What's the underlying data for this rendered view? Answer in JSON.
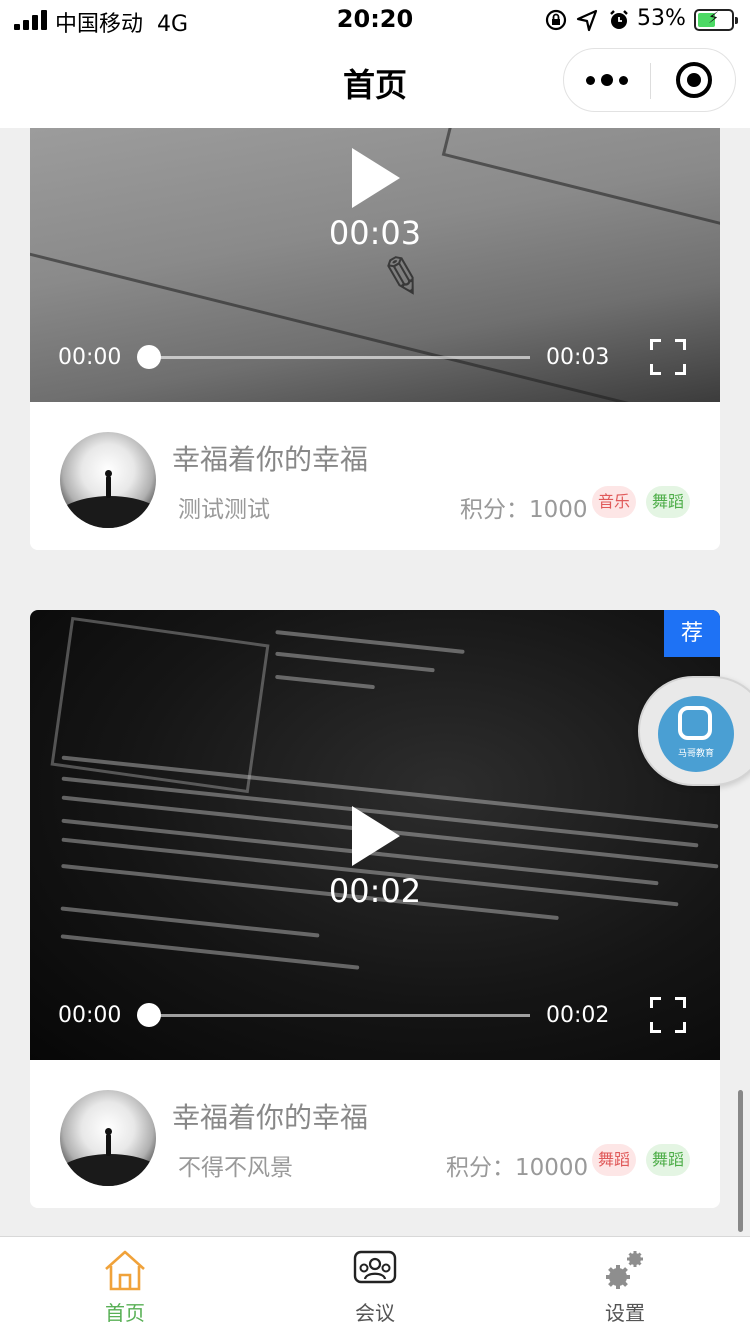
{
  "status_bar": {
    "carrier": "中国移动",
    "network": "4G",
    "time": "20:20",
    "battery_percent": "53%",
    "battery_level": 0.53,
    "icons": [
      "lock-rotation-icon",
      "location-arrow-icon",
      "alarm-icon",
      "battery-charging-icon"
    ]
  },
  "nav": {
    "title": "首页",
    "capsule": {
      "more_icon": "more-dots-icon",
      "close_icon": "target-close-icon"
    }
  },
  "posts": [
    {
      "video": {
        "duration_center": "00:03",
        "current_time": "00:00",
        "total_time": "00:03",
        "progress": 0,
        "recommended": false
      },
      "title": "幸福着你的幸福",
      "desc": "测试测试",
      "score": "积分：1000",
      "tags": [
        {
          "label": "音乐",
          "color": "#e05a5a"
        },
        {
          "label": "舞蹈",
          "color": "#4fae4a"
        }
      ]
    },
    {
      "video": {
        "duration_center": "00:02",
        "current_time": "00:00",
        "total_time": "00:02",
        "progress": 0,
        "recommended": true,
        "badge": "荐"
      },
      "title": "幸福着你的幸福",
      "desc": "不得不风景",
      "score": "积分：10000",
      "tags": [
        {
          "label": "舞蹈",
          "color": "#e05a5a"
        },
        {
          "label": "舞蹈",
          "color": "#4fae4a"
        }
      ]
    }
  ],
  "float_badge": {
    "name": "马哥教育",
    "url": "www.magedu.com"
  },
  "tab_bar": {
    "active_color": "#59b056",
    "items": [
      {
        "label": "首页",
        "icon": "home-icon",
        "active": true
      },
      {
        "label": "会议",
        "icon": "meeting-people-icon",
        "active": false
      },
      {
        "label": "设置",
        "icon": "settings-gears-icon",
        "active": false
      }
    ]
  }
}
